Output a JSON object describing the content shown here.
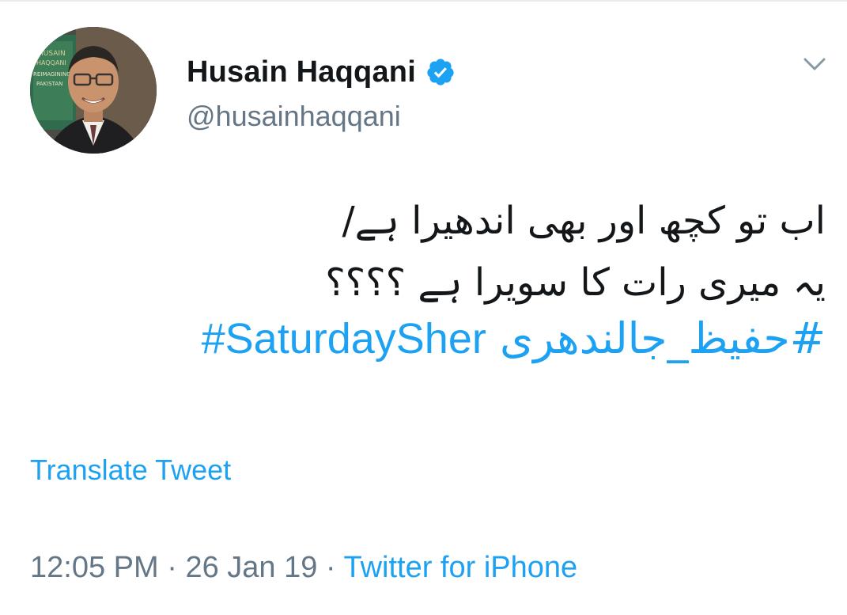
{
  "author": {
    "display_name": "Husain Haqqani",
    "handle": "@husainhaqqani",
    "verified": true,
    "avatar_book_text": [
      "HUSAIN",
      "HAQQANI",
      "REIMAGINING",
      "PAKISTAN"
    ]
  },
  "tweet": {
    "lines": [
      "اب تو کچھ اور بھی اندھیرا ہے/",
      "یہ میری رات کا سویرا ہے ؟؟؟؟"
    ],
    "hashtags": [
      "#حفیظ_جالندھری",
      "#SaturdaySher"
    ]
  },
  "translate_label": "Translate Tweet",
  "meta": {
    "time": "12:05 PM",
    "date": "26 Jan 19",
    "separator": "·",
    "source": "Twitter for iPhone"
  },
  "icons": {
    "verified": "verified-badge-icon",
    "menu": "chevron-down-icon"
  },
  "colors": {
    "link": "#1da1f2",
    "text": "#14171a",
    "secondary": "#657786"
  }
}
